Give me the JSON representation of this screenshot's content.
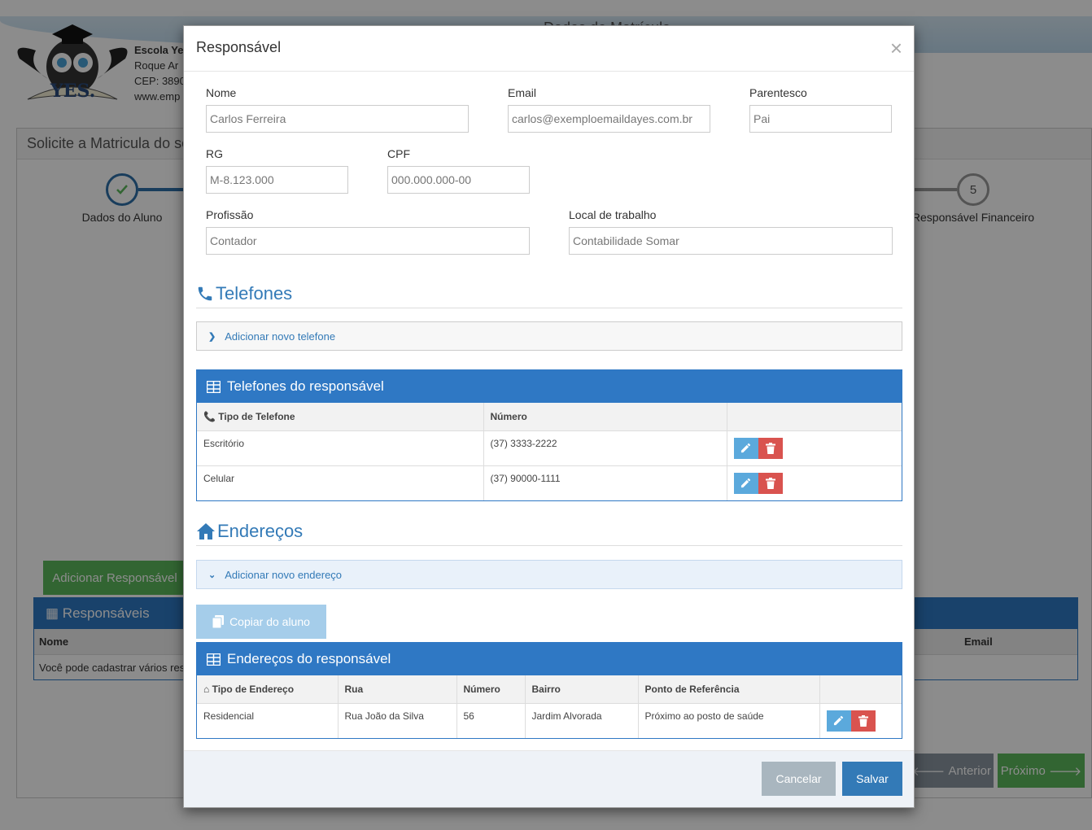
{
  "background": {
    "school_name": "Escola Ye",
    "school_line2": "Roque Ar",
    "school_line3": "CEP: 3890",
    "school_line4": "www.emp",
    "page_heading": "Dados do Matrícula",
    "panel_title": "Solicite a Matricula do se",
    "step1_label": "Dados do Aluno",
    "step5_number": "5",
    "step5_label": "Responsável Financeiro",
    "add_responsavel_label": "Adicionar Responsável",
    "responsaveis_title": "Responsáveis",
    "col_nome": "Nome",
    "col_email": "Email",
    "hint_text": "Você pode cadastrar vários resp",
    "prev_label": "Anterior",
    "next_label": "Próximo"
  },
  "modal": {
    "title": "Responsável",
    "close": "×",
    "form": {
      "nome_label": "Nome",
      "nome_value": "Carlos Ferreira",
      "email_label": "Email",
      "email_value": "carlos@exemploemaildayes.com.br",
      "parentesco_label": "Parentesco",
      "parentesco_value": "Pai",
      "rg_label": "RG",
      "rg_value": "M-8.123.000",
      "cpf_label": "CPF",
      "cpf_placeholder": "000.000.000-00",
      "profissao_label": "Profissão",
      "profissao_value": "Contador",
      "local_label": "Local de trabalho",
      "local_value": "Contabilidade Somar"
    },
    "telefones": {
      "section_title": "Telefones",
      "add_label": "Adicionar novo telefone",
      "table_title": "Telefones do responsável",
      "columns": [
        "Tipo de Telefone",
        "Número",
        ""
      ],
      "rows": [
        {
          "tipo": "Escritório",
          "numero": "(37) 3333-2222"
        },
        {
          "tipo": "Celular",
          "numero": "(37) 90000-1111"
        }
      ]
    },
    "enderecos": {
      "section_title": "Endereços",
      "add_label": "Adicionar novo endereço",
      "copy_label": "Copiar do aluno",
      "table_title": "Endereços do responsável",
      "columns": [
        "Tipo de Endereço",
        "Rua",
        "Número",
        "Bairro",
        "Ponto de Referência",
        ""
      ],
      "rows": [
        {
          "tipo": "Residencial",
          "rua": "Rua João da Silva",
          "numero": "56",
          "bairro": "Jardim Alvorada",
          "referencia": "Próximo ao posto de saúde"
        }
      ]
    },
    "footer": {
      "cancel_label": "Cancelar",
      "save_label": "Salvar"
    }
  },
  "colors": {
    "primary": "#337ab7",
    "table_header": "#2f78c4",
    "danger": "#d9534f",
    "success": "#5cb85c"
  }
}
